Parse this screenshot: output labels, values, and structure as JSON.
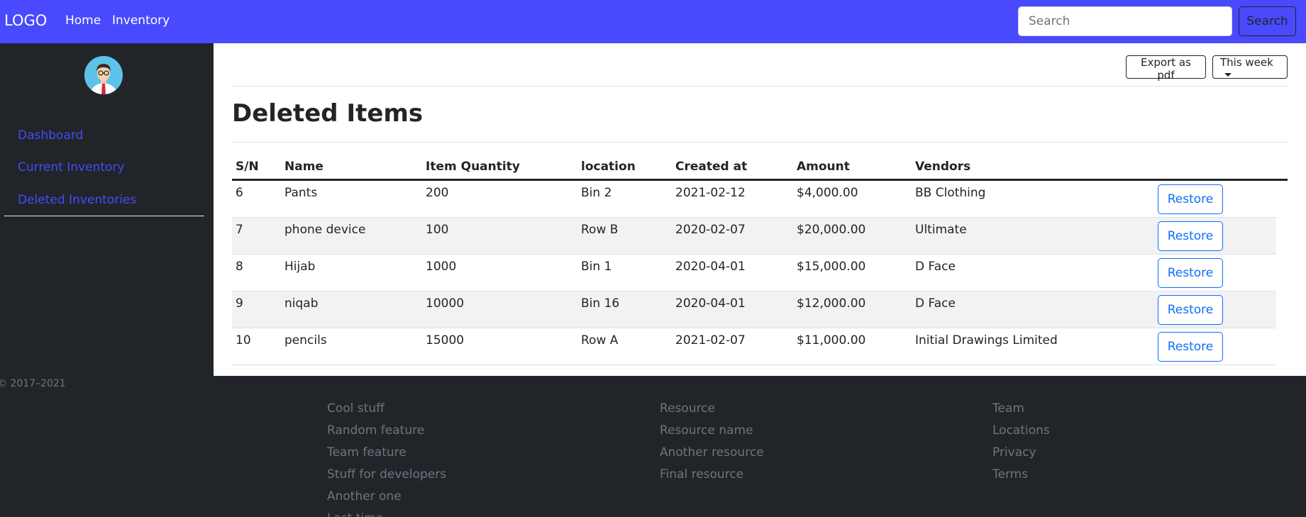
{
  "navbar": {
    "brand": "LOGO",
    "links": [
      "Home",
      "Inventory"
    ],
    "search_placeholder": "Search",
    "search_button": "Search"
  },
  "sidebar": {
    "avatar_icon": "user-avatar-icon",
    "items": [
      "Dashboard",
      "Current Inventory",
      "Deleted Inventories"
    ],
    "link_color": "#4949fd"
  },
  "main": {
    "export_button": "Export as pdf",
    "period_dropdown": "This week",
    "title": "Deleted Items",
    "table": {
      "headers": [
        "S/N",
        "Name",
        "Item Quantity",
        "location",
        "Created at",
        "Amount",
        "Vendors"
      ],
      "rows": [
        {
          "sn": "6",
          "name": "Pants",
          "quantity": "200",
          "location": "Bin 2",
          "created_at": "2021-02-12",
          "amount": "$4,000.00",
          "vendor": "BB Clothing",
          "action": "Restore"
        },
        {
          "sn": "7",
          "name": "phone device",
          "quantity": "100",
          "location": "Row B",
          "created_at": "2020-02-07",
          "amount": "$20,000.00",
          "vendor": "Ultimate",
          "action": "Restore"
        },
        {
          "sn": "8",
          "name": "Hijab",
          "quantity": "1000",
          "location": "Bin 1",
          "created_at": "2020-04-01",
          "amount": "$15,000.00",
          "vendor": "D Face",
          "action": "Restore"
        },
        {
          "sn": "9",
          "name": "niqab",
          "quantity": "10000",
          "location": "Bin 16",
          "created_at": "2020-04-01",
          "amount": "$12,000.00",
          "vendor": "D Face",
          "action": "Restore"
        },
        {
          "sn": "10",
          "name": "pencils",
          "quantity": "15000",
          "location": "Row A",
          "created_at": "2021-02-07",
          "amount": "$11,000.00",
          "vendor": "Initial Drawings Limited",
          "action": "Restore"
        }
      ]
    }
  },
  "footer": {
    "copyright": "© 2017–2021",
    "columns": [
      [
        "Cool stuff",
        "Random feature",
        "Team feature",
        "Stuff for developers",
        "Another one",
        "Last time"
      ],
      [
        "Resource",
        "Resource name",
        "Another resource",
        "Final resource"
      ],
      [
        "Team",
        "Locations",
        "Privacy",
        "Terms"
      ]
    ]
  },
  "colors": {
    "navbar": "#4949fd",
    "dark": "#212529",
    "restore": "#0d6efd"
  }
}
